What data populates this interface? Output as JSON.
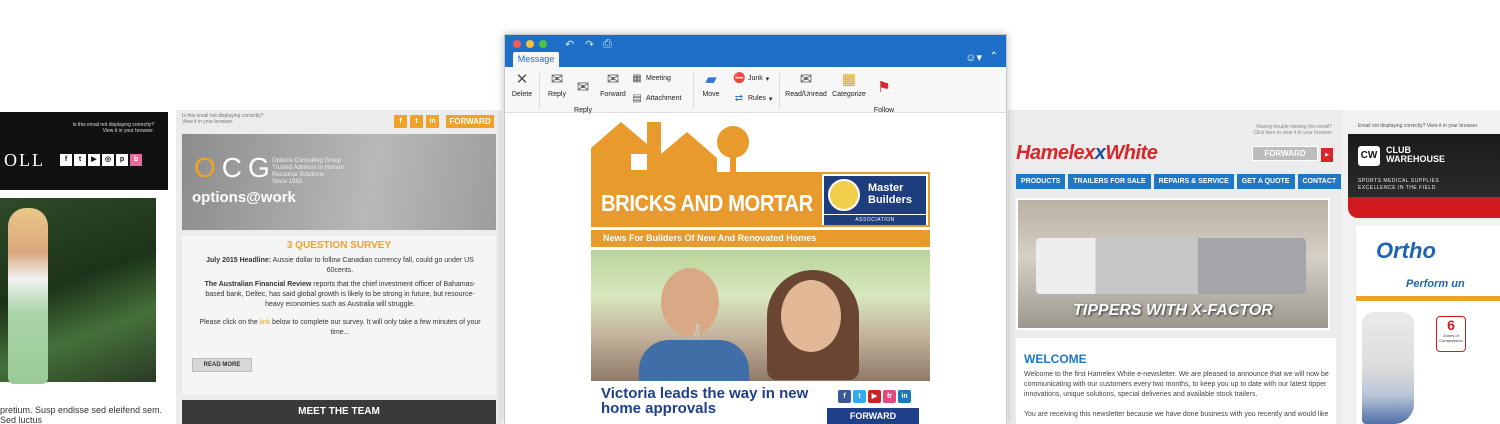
{
  "fashion_email": {
    "note": "Is this email not displaying correctly?\nView it in your browser.",
    "brand": "OLL",
    "social_icons": [
      "facebook-icon",
      "twitter-icon",
      "youtube-icon",
      "instagram-icon",
      "pinterest-icon",
      "blog-icon"
    ],
    "body_text": "pretium. Susp endisse sed eleifend sem. Sed luctus"
  },
  "ocg_email": {
    "note": "Is this email not displaying correctly?\nView it in your browser.",
    "forward_label": "FORWARD",
    "social_icons": [
      "facebook-icon",
      "twitter-icon",
      "linkedin-icon"
    ],
    "logo_letters": [
      "O",
      "C",
      "G"
    ],
    "org_text": "Options Consulting Group\nTrusted Advisors in Human\nResource Solutions\nSince 1983",
    "tagline": "options@work",
    "survey_title": "3 QUESTION SURVEY",
    "headline_label": "July 2015 Headline:",
    "headline_text": " Aussie dollar to follow Canadian currency fall, could go under US 60cents.",
    "review_label": "The Australian Financial Review",
    "review_text": " reports that the chief investment officer of Bahamas-based bank, Deltec, has said global growth is likely to be strong in future, but resource-heavy economies such as Australia will struggle.",
    "click_before": "Please click on the ",
    "click_link": "link",
    "click_after": " below to complete our survey. It will only take a few minutes of your time...",
    "read_more": "READ MORE",
    "team_label": "MEET THE TEAM"
  },
  "outlook": {
    "tab_label": "Message",
    "ribbon": {
      "delete": "Delete",
      "reply": "Reply",
      "reply_all": "Reply\nAll",
      "forward": "Forward",
      "meeting": "Meeting",
      "attachment": "Attachment",
      "move": "Move",
      "junk": "Junk",
      "rules": "Rules",
      "read_unread": "Read/Unread",
      "categorize": "Categorize",
      "follow_up": "Follow\nUp"
    },
    "newsletter": {
      "title": "BRICKS AND MORTAR",
      "association_name": "Master\nBuilders",
      "association_label": "ASSOCIATION",
      "subtitle": "News For Builders Of New And Renovated Homes",
      "headline": "Victoria leads the way in new home approvals",
      "social_icons": [
        "facebook-icon",
        "twitter-icon",
        "youtube-icon",
        "flickr-icon",
        "linkedin-icon"
      ],
      "forward_label": "FORWARD"
    }
  },
  "hamelex_email": {
    "note": "Having trouble viewing this email?\nClick here to view it in your browser",
    "logo_part1": "Hamelex",
    "logo_part2": "White",
    "forward_label": "FORWARD",
    "nav": [
      "PRODUCTS",
      "TRAILERS FOR SALE",
      "REPAIRS & SERVICE",
      "GET A QUOTE",
      "CONTACT"
    ],
    "hero_caption": "TIPPERS WITH X-FACTOR",
    "welcome_title": "WELCOME",
    "para1": "Welcome to the first Hamelex White e-newsletter. We are pleased to announce that we will now be communicating with our customers every two months, to keep you up to date with our latest tipper innovations, unique solutions, special deliveries and available stock trailers.",
    "para2": "You are receiving this newsletter because we have done business with you recently and would like"
  },
  "clubwarehouse_email": {
    "note_before": "Email not displaying correctly? ",
    "note_link": "View it in your browser.",
    "logo_mark": "CW",
    "name": "CLUB\nWAREHOUSE",
    "tagline": "SPORTS MEDICAL SUPPLIES\nEXCELLENCE IN THE FIELD",
    "product_brand": "Ortho",
    "product_tagline": "Perform un",
    "zones_number": "6",
    "zones_label": "Zones of\nCompression"
  },
  "colors": {
    "outlook_blue": "#1d6fc7",
    "bricks_orange": "#e89a2d",
    "master_builders_navy": "#1d3d7d",
    "ocg_orange": "#f0a12a",
    "hamelex_red": "#d8262a",
    "hamelex_blue": "#1f77c8",
    "clubwarehouse_red": "#d11a1f"
  }
}
